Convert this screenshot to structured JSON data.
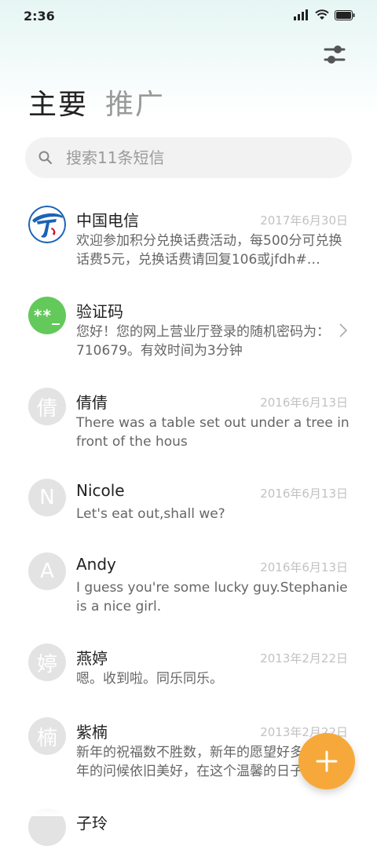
{
  "status": {
    "time": "2:36"
  },
  "tabs": [
    {
      "label": "主要"
    },
    {
      "label": "推广"
    }
  ],
  "search": {
    "placeholder": "搜索11条短信"
  },
  "threads": [
    {
      "name": "中国电信",
      "date": "2017年6月30日",
      "preview": "欢迎参加积分兑换话费活动，每500分可兑换话费5元，兑换话费请回复106或jfdh#…",
      "avatar": "china-telecom-logo"
    },
    {
      "name": "验证码",
      "date": "",
      "preview": "您好！您的网上营业厅登录的随机密码为：710679。有效时间为3分钟",
      "avatar_text": "**_"
    },
    {
      "name": "倩倩",
      "date": "2016年6月13日",
      "preview": "There was a table set out under a tree in front of the hous",
      "avatar_text": "倩"
    },
    {
      "name": "Nicole",
      "date": "2016年6月13日",
      "preview": "Let's eat out,shall we?",
      "avatar_text": "N"
    },
    {
      "name": "Andy",
      "date": "2016年6月13日",
      "preview": "I guess you're some lucky guy.Stephanie is a nice girl.",
      "avatar_text": "A"
    },
    {
      "name": "燕婷",
      "date": "2013年2月22日",
      "preview": "嗯。收到啦。同乐同乐。",
      "avatar_text": "婷"
    },
    {
      "name": "紫楠",
      "date": "2013年2月22日",
      "preview": "新年的祝福数不胜数，新年的愿望好多多，新年的问候依旧美好，在这个温馨的日子",
      "avatar_text": "楠"
    },
    {
      "name": "子玲",
      "date": "",
      "preview": "",
      "avatar_text": ""
    }
  ],
  "colors": {
    "accent": "#f6a93a",
    "verify_green": "#63c95b",
    "telecom_blue": "#1b62b5"
  },
  "icons": {
    "filter": "sliders-icon",
    "search": "search-icon",
    "compose": "plus-icon",
    "chevron": "chevron-right-icon"
  }
}
